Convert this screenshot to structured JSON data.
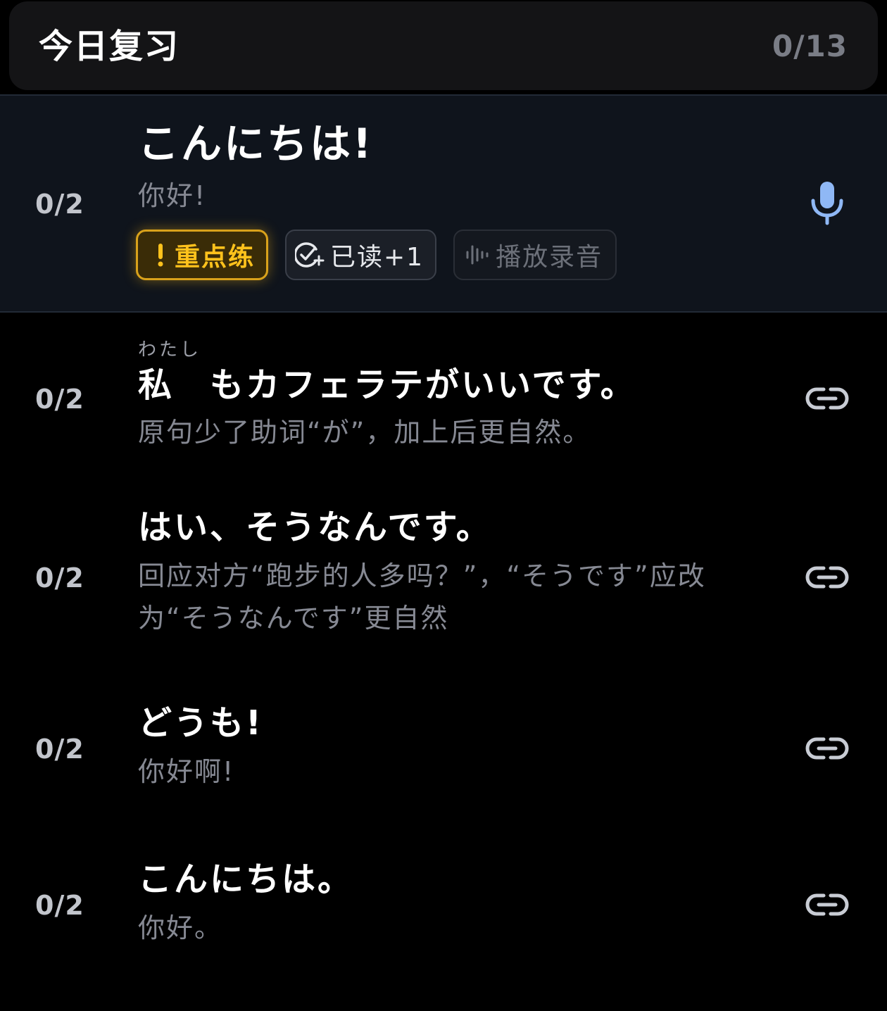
{
  "header": {
    "title": "今日复习",
    "count": "0/13"
  },
  "items": [
    {
      "progress": "0/2",
      "sentence": "こんにちは!",
      "translation": "你好!",
      "action_icon": "microphone-icon",
      "chips": {
        "focus": {
          "icon": "exclamation-icon",
          "label": "重点练"
        },
        "read": {
          "icon": "check-circle-plus-icon",
          "label": "已读+1"
        },
        "play": {
          "icon": "waveform-icon",
          "label": "播放录音"
        }
      }
    },
    {
      "progress": "0/2",
      "ruby": "わたし",
      "sentence": "私　もカフェラテがいいです。",
      "translation": "原句少了助词“が”，加上后更自然。",
      "action_icon": "link-icon"
    },
    {
      "progress": "0/2",
      "sentence": "はい、そうなんです。",
      "translation": "回应对方“跑步的人多吗？”，“そうです”应改为“そうなんです”更自然",
      "action_icon": "link-icon"
    },
    {
      "progress": "0/2",
      "sentence": "どうも!",
      "translation": "你好啊!",
      "action_icon": "link-icon"
    },
    {
      "progress": "0/2",
      "sentence": "こんにちは。",
      "translation": "你好。",
      "action_icon": "link-icon"
    }
  ],
  "colors": {
    "background": "#000000",
    "header_bg": "#141416",
    "active_bg": "#0f141c",
    "focus_accent": "#ffc21c",
    "mic_accent": "#8fb8f5",
    "muted_text": "#868993"
  }
}
